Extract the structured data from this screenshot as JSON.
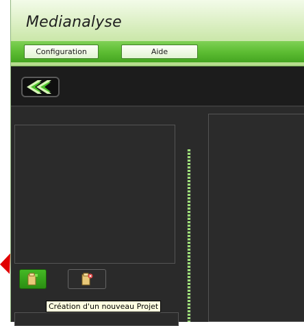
{
  "app": {
    "title": "Medianalyse"
  },
  "menu": {
    "configuration": "Configuration",
    "aide": "Aide"
  },
  "toolbar": {
    "back_icon": "double-chevron-left-icon"
  },
  "actions": {
    "new_project_icon": "folder-new-icon",
    "delete_project_icon": "folder-delete-icon"
  },
  "tooltip": {
    "text": "Création d'un nouveau Projet"
  },
  "colors": {
    "accent_green": "#5dbd33",
    "header_green": "#cfe9b0",
    "dark_bg": "#222222",
    "pointer_red": "#e00000"
  }
}
